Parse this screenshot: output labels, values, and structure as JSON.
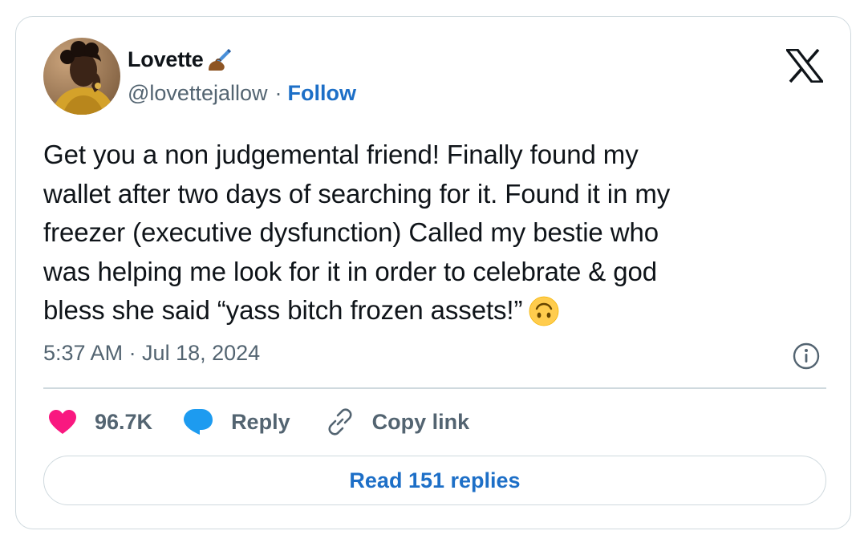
{
  "tweet": {
    "author": {
      "display_name": "Lovette",
      "name_emoji": "writing-hand-emoji",
      "handle": "@lovettejallow",
      "separator": "·",
      "follow_label": "Follow"
    },
    "text": "Get you a non judgemental friend! Finally found my\nwallet after two days of searching for it. Found it in my\nfreezer (executive dysfunction) Called my bestie who\nwas helping me look for it in order to celebrate & god\nbless she said “yass bitch frozen assets!”",
    "trailing_emoji": "upside-down-face-emoji",
    "timestamp": "5:37 AM · Jul 18, 2024",
    "actions": {
      "like_count": "96.7K",
      "reply_label": "Reply",
      "copy_link_label": "Copy link"
    },
    "read_replies_label": "Read 151 replies"
  },
  "icons": {
    "brand_logo": "x-logo-icon",
    "info": "info-icon",
    "like": "heart-icon",
    "reply": "speech-bubble-icon",
    "copy_link": "link-icon"
  },
  "colors": {
    "link_blue": "#1d6fc7",
    "like_pink": "#f91880",
    "reply_blue": "#1d9bf0",
    "secondary_text": "#536471",
    "border": "#cfd9de"
  }
}
